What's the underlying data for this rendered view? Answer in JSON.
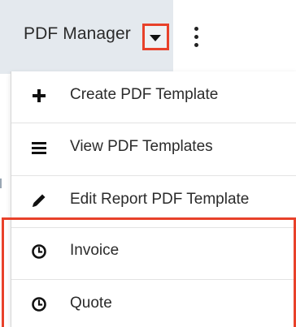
{
  "header": {
    "tab_label": "PDF Manager",
    "caret_icon": "caret-down-icon",
    "more_icon": "vertical-dots-icon"
  },
  "menu": {
    "items": [
      {
        "label": "Create PDF Template",
        "icon": "plus-icon"
      },
      {
        "label": "View PDF Templates",
        "icon": "list-icon"
      },
      {
        "label": "Edit Report PDF Template",
        "icon": "pencil-icon"
      },
      {
        "label": "Invoice",
        "icon": "clock-icon"
      },
      {
        "label": "Quote",
        "icon": "clock-icon"
      }
    ]
  },
  "colors": {
    "highlight": "#e8412a",
    "tab_background": "#e4e9ee",
    "text": "#2b2b2b"
  }
}
